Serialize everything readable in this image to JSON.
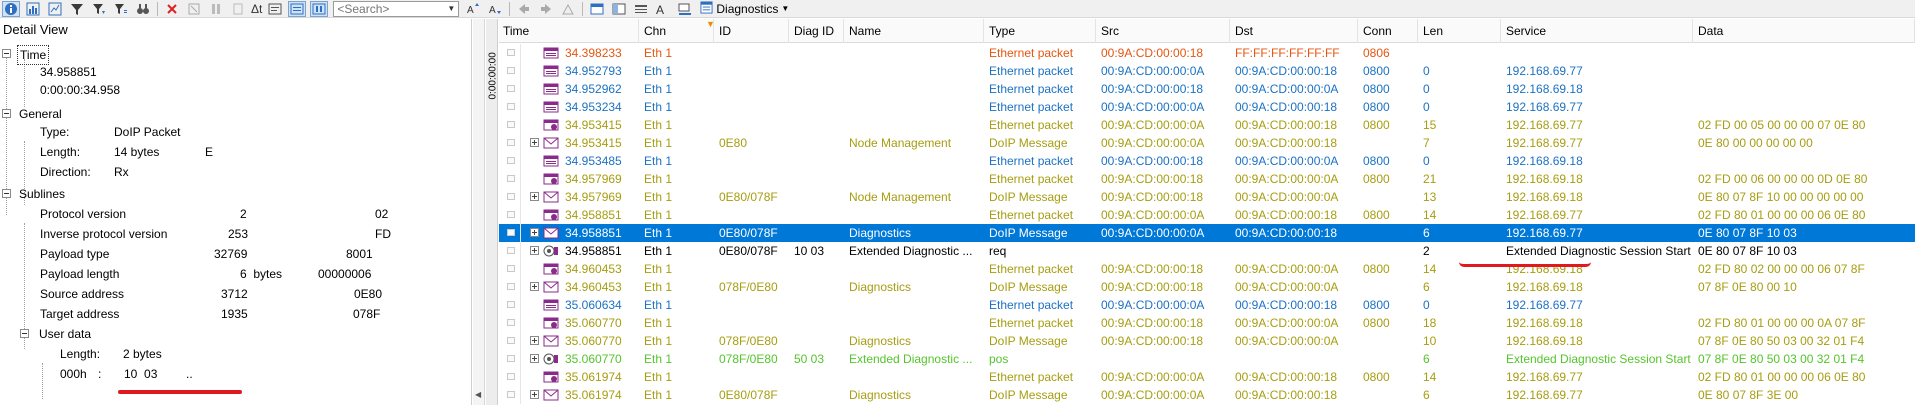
{
  "toolbar": {
    "search_placeholder": "<Search>",
    "delta_label": "Δt",
    "view_dropdown_label": "Diagnostics"
  },
  "detail": {
    "title": "Detail View",
    "time": {
      "label": "Time",
      "values": [
        "34.958851",
        "0:00:00:34.958"
      ]
    },
    "general": {
      "label": "General",
      "rows": [
        {
          "name": "Type:",
          "value": "DoIP Packet",
          "extra": ""
        },
        {
          "name": "Length:",
          "value": "14 bytes",
          "extra": "E"
        },
        {
          "name": "Direction:",
          "value": "Rx",
          "extra": ""
        }
      ]
    },
    "sublines": {
      "label": "Sublines",
      "rows": [
        {
          "name": "Protocol version",
          "dec": "2",
          "hex": "02"
        },
        {
          "name": "Inverse protocol version",
          "dec": "253",
          "hex": "FD"
        },
        {
          "name": "Payload type",
          "dec": "32769",
          "hex": "8001"
        },
        {
          "name": "Payload length",
          "dec": "6  bytes",
          "hex": "00000006"
        },
        {
          "name": "Source address",
          "dec": "3712",
          "hex": "0E80"
        },
        {
          "name": "Target address",
          "dec": "1935",
          "hex": "078F"
        }
      ]
    },
    "user_data": {
      "label": "User data",
      "length_name": "Length:",
      "length_value": "2 bytes",
      "offset": "000h",
      "sep": ":",
      "bytes": "10  03",
      "ascii": ".."
    }
  },
  "ruler": {
    "label": "0:00:00:00"
  },
  "trace": {
    "columns": [
      "Time",
      "Chn",
      "ID",
      "Diag ID",
      "Name",
      "Type",
      "Src",
      "Dst",
      "Conn",
      "Len",
      "Service",
      "Data"
    ],
    "rows": [
      {
        "expand": false,
        "icon": "eth",
        "color": "c-orange",
        "time": "34.398233",
        "chn": "Eth 1",
        "id": "",
        "diag": "",
        "name": "",
        "type": "Ethernet packet",
        "src": "00:9A:CD:00:00:18",
        "dst": "FF:FF:FF:FF:FF:FF",
        "conn": "0806",
        "len": "",
        "service": "",
        "data": ""
      },
      {
        "expand": false,
        "icon": "eth",
        "color": "c-blue",
        "time": "34.952793",
        "chn": "Eth 1",
        "id": "",
        "diag": "",
        "name": "",
        "type": "Ethernet packet",
        "src": "00:9A:CD:00:00:0A",
        "dst": "00:9A:CD:00:00:18",
        "conn": "0800",
        "len": "0",
        "service": "192.168.69.77",
        "data": ""
      },
      {
        "expand": false,
        "icon": "eth",
        "color": "c-blue",
        "time": "34.952962",
        "chn": "Eth 1",
        "id": "",
        "diag": "",
        "name": "",
        "type": "Ethernet packet",
        "src": "00:9A:CD:00:00:18",
        "dst": "00:9A:CD:00:00:0A",
        "conn": "0800",
        "len": "0",
        "service": "192.168.69.18",
        "data": ""
      },
      {
        "expand": false,
        "icon": "eth",
        "color": "c-blue",
        "time": "34.953234",
        "chn": "Eth 1",
        "id": "",
        "diag": "",
        "name": "",
        "type": "Ethernet packet",
        "src": "00:9A:CD:00:00:0A",
        "dst": "00:9A:CD:00:00:18",
        "conn": "0800",
        "len": "0",
        "service": "192.168.69.77",
        "data": ""
      },
      {
        "expand": false,
        "icon": "pkt",
        "color": "c-olive",
        "time": "34.953415",
        "chn": "Eth 1",
        "id": "",
        "diag": "",
        "name": "",
        "type": "Ethernet packet",
        "src": "00:9A:CD:00:00:0A",
        "dst": "00:9A:CD:00:00:18",
        "conn": "0800",
        "len": "15",
        "service": "192.168.69.77",
        "data": "02 FD 00 05 00 00 00 07 0E 80"
      },
      {
        "expand": true,
        "icon": "msg",
        "color": "c-olive",
        "time": "34.953415",
        "chn": "Eth 1",
        "id": "0E80",
        "diag": "",
        "name": "Node Management",
        "type": "DoIP Message",
        "src": "00:9A:CD:00:00:0A",
        "dst": "00:9A:CD:00:00:18",
        "conn": "",
        "len": "7",
        "service": "192.168.69.77",
        "data": "0E 80 00 00 00 00 00"
      },
      {
        "expand": false,
        "icon": "eth",
        "color": "c-blue",
        "time": "34.953485",
        "chn": "Eth 1",
        "id": "",
        "diag": "",
        "name": "",
        "type": "Ethernet packet",
        "src": "00:9A:CD:00:00:18",
        "dst": "00:9A:CD:00:00:0A",
        "conn": "0800",
        "len": "0",
        "service": "192.168.69.18",
        "data": ""
      },
      {
        "expand": false,
        "icon": "pkt",
        "color": "c-olive",
        "time": "34.957969",
        "chn": "Eth 1",
        "id": "",
        "diag": "",
        "name": "",
        "type": "Ethernet packet",
        "src": "00:9A:CD:00:00:18",
        "dst": "00:9A:CD:00:00:0A",
        "conn": "0800",
        "len": "21",
        "service": "192.168.69.18",
        "data": "02 FD 00 06 00 00 00 0D 0E 80"
      },
      {
        "expand": true,
        "icon": "msg",
        "color": "c-olive",
        "time": "34.957969",
        "chn": "Eth 1",
        "id": "0E80/078F",
        "diag": "",
        "name": "Node Management",
        "type": "DoIP Message",
        "src": "00:9A:CD:00:00:18",
        "dst": "00:9A:CD:00:00:0A",
        "conn": "",
        "len": "13",
        "service": "192.168.69.18",
        "data": "0E 80 07 8F 10 00 00 00 00 00"
      },
      {
        "expand": false,
        "icon": "pkt",
        "color": "c-olive",
        "time": "34.958851",
        "chn": "Eth 1",
        "id": "",
        "diag": "",
        "name": "",
        "type": "Ethernet packet",
        "src": "00:9A:CD:00:00:0A",
        "dst": "00:9A:CD:00:00:18",
        "conn": "0800",
        "len": "14",
        "service": "192.168.69.77",
        "data": "02 FD 80 01 00 00 00 06 0E 80"
      },
      {
        "expand": true,
        "icon": "msg",
        "color": "c-black",
        "selected": true,
        "time": "34.958851",
        "chn": "Eth 1",
        "id": "0E80/078F",
        "diag": "",
        "name": "Diagnostics",
        "type": "DoIP Message",
        "src": "00:9A:CD:00:00:0A",
        "dst": "00:9A:CD:00:00:18",
        "conn": "",
        "len": "6",
        "service": "192.168.69.77",
        "data": "0E 80 07 8F 10 03"
      },
      {
        "expand": true,
        "icon": "diag",
        "color": "c-black",
        "time": "34.958851",
        "chn": "Eth 1",
        "id": "0E80/078F",
        "diag": "10 03",
        "name": "Extended Diagnostic ...",
        "type": "req",
        "src": "",
        "dst": "",
        "conn": "",
        "len": "2",
        "service": "Extended Diagnostic Session Start",
        "data": "0E 80 07 8F 10 03"
      },
      {
        "expand": false,
        "icon": "pkt",
        "color": "c-olive",
        "time": "34.960453",
        "chn": "Eth 1",
        "id": "",
        "diag": "",
        "name": "",
        "type": "Ethernet packet",
        "src": "00:9A:CD:00:00:18",
        "dst": "00:9A:CD:00:00:0A",
        "conn": "0800",
        "len": "14",
        "service": "192.168.69.18",
        "data": "02 FD 80 02 00 00 00 06 07 8F"
      },
      {
        "expand": true,
        "icon": "msg",
        "color": "c-olive",
        "time": "34.960453",
        "chn": "Eth 1",
        "id": "078F/0E80",
        "diag": "",
        "name": "Diagnostics",
        "type": "DoIP Message",
        "src": "00:9A:CD:00:00:18",
        "dst": "00:9A:CD:00:00:0A",
        "conn": "",
        "len": "6",
        "service": "192.168.69.18",
        "data": "07 8F 0E 80 00 10"
      },
      {
        "expand": false,
        "icon": "eth",
        "color": "c-blue",
        "time": "35.060634",
        "chn": "Eth 1",
        "id": "",
        "diag": "",
        "name": "",
        "type": "Ethernet packet",
        "src": "00:9A:CD:00:00:0A",
        "dst": "00:9A:CD:00:00:18",
        "conn": "0800",
        "len": "0",
        "service": "192.168.69.77",
        "data": ""
      },
      {
        "expand": false,
        "icon": "pkt",
        "color": "c-olive",
        "time": "35.060770",
        "chn": "Eth 1",
        "id": "",
        "diag": "",
        "name": "",
        "type": "Ethernet packet",
        "src": "00:9A:CD:00:00:18",
        "dst": "00:9A:CD:00:00:0A",
        "conn": "0800",
        "len": "18",
        "service": "192.168.69.18",
        "data": "02 FD 80 01 00 00 00 0A 07 8F"
      },
      {
        "expand": true,
        "icon": "msg",
        "color": "c-olive",
        "time": "35.060770",
        "chn": "Eth 1",
        "id": "078F/0E80",
        "diag": "",
        "name": "Diagnostics",
        "type": "DoIP Message",
        "src": "00:9A:CD:00:00:18",
        "dst": "00:9A:CD:00:00:0A",
        "conn": "",
        "len": "10",
        "service": "192.168.69.18",
        "data": "07 8F 0E 80 50 03 00 32 01 F4"
      },
      {
        "expand": true,
        "icon": "diag",
        "color": "c-green",
        "time": "35.060770",
        "chn": "Eth 1",
        "id": "078F/0E80",
        "diag": "50 03",
        "name": "Extended Diagnostic ...",
        "type": "pos",
        "src": "",
        "dst": "",
        "conn": "",
        "len": "6",
        "service": "Extended Diagnostic Session Start",
        "data": "07 8F 0E 80 50 03 00 32 01 F4"
      },
      {
        "expand": false,
        "icon": "pkt",
        "color": "c-olive",
        "time": "35.061974",
        "chn": "Eth 1",
        "id": "",
        "diag": "",
        "name": "",
        "type": "Ethernet packet",
        "src": "00:9A:CD:00:00:0A",
        "dst": "00:9A:CD:00:00:18",
        "conn": "0800",
        "len": "14",
        "service": "192.168.69.77",
        "data": "02 FD 80 01 00 00 00 06 0E 80"
      },
      {
        "expand": true,
        "icon": "msg",
        "color": "c-olive",
        "time": "35.061974",
        "chn": "Eth 1",
        "id": "0E80/078F",
        "diag": "",
        "name": "Diagnostics",
        "type": "DoIP Message",
        "src": "00:9A:CD:00:00:0A",
        "dst": "00:9A:CD:00:00:18",
        "conn": "",
        "len": "6",
        "service": "192.168.69.77",
        "data": "0E 80 07 8F 3E 00"
      }
    ]
  }
}
